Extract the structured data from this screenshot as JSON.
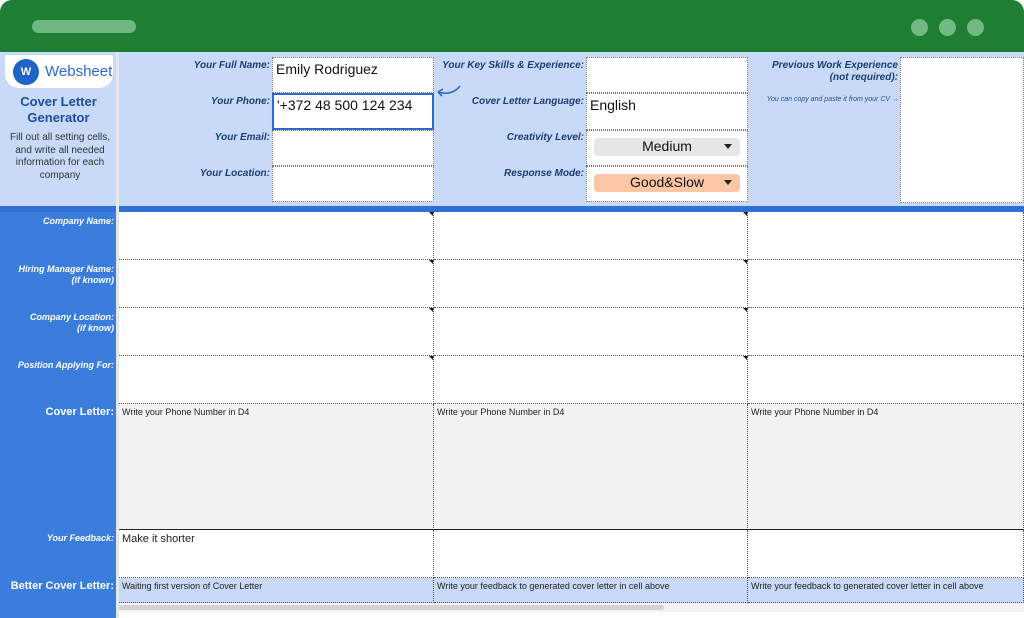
{
  "brand": {
    "logo_text": "Websheet",
    "title": "Cover Letter Generator",
    "description": "Fill out all setting cells, and write all needed information for each company"
  },
  "settings": {
    "full_name_label": "Your Full Name:",
    "full_name_value": "Emily Rodriguez",
    "phone_label": "Your Phone:",
    "phone_value": "'+372 48 500 124 234",
    "email_label": "Your Email:",
    "email_value": "",
    "location_label": "Your Location:",
    "location_value": "",
    "skills_label": "Your Key Skills & Experience:",
    "skills_value": "",
    "language_label": "Cover Letter Language:",
    "language_value": "English",
    "creativity_label": "Creativity Level:",
    "creativity_value": "Medium",
    "response_label": "Response Mode:",
    "response_value": "Good&Slow",
    "prev_work_label_1": "Previous Work Experience",
    "prev_work_label_2": "(not required):",
    "prev_work_hint": "You can copy and paste it from your CV →"
  },
  "rows": {
    "company_name": "Company Name:",
    "hiring_manager_1": "Hiring Manager Name:",
    "hiring_manager_2": "(if known)",
    "company_location_1": "Company Location:",
    "company_location_2": "(if know)",
    "position": "Position Applying For:",
    "cover_letter": "Cover Letter:",
    "feedback": "Your Feedback:",
    "better_cover_letter": "Better Cover Letter:"
  },
  "grid": {
    "cover_letter": [
      "Write your Phone Number in D4",
      "Write your Phone Number in D4",
      "Write your Phone Number in D4"
    ],
    "feedback": [
      "Make it shorter",
      "",
      ""
    ],
    "better_cover_letter": [
      "Waiting first version of Cover Letter",
      "Write your feedback to generated cover letter in cell above",
      "Write your feedback to generated cover letter in cell above"
    ]
  },
  "colors": {
    "titlebar": "#1e7e34",
    "header_bg": "#c8daf7",
    "label_column": "#3b7ddd",
    "creativity_dropdown": "#e6e6e6",
    "response_dropdown": "#fbc6a4"
  }
}
